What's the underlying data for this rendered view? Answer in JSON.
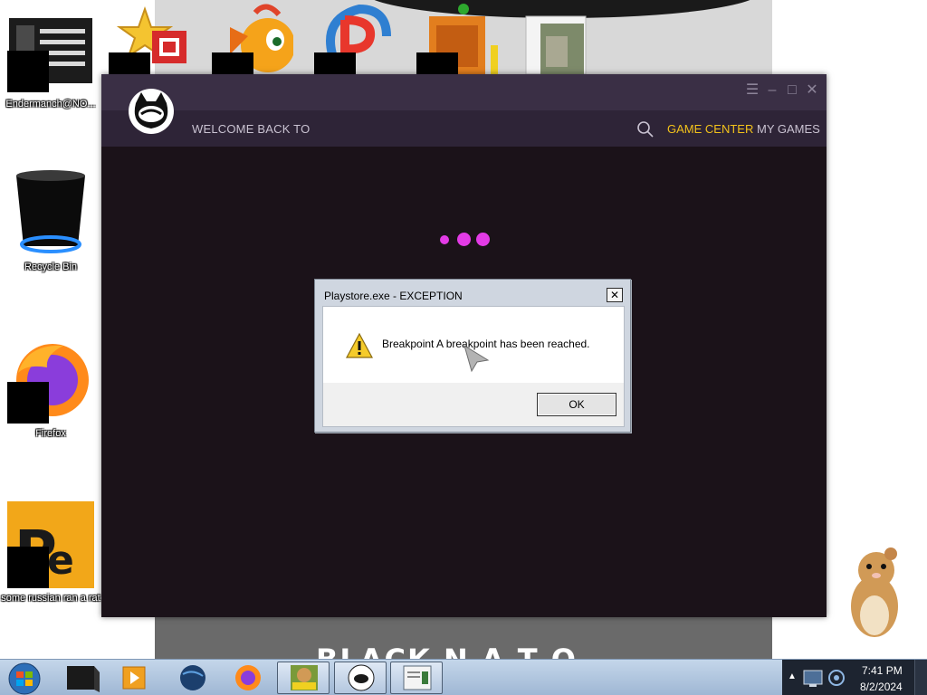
{
  "desktop": {
    "icons": [
      {
        "label": "Endermanch@NO...",
        "icon": "notepad-icon"
      },
      {
        "label": "Recycle Bin",
        "icon": "recycle-bin-icon"
      },
      {
        "label": "Firefox",
        "icon": "firefox-icon"
      },
      {
        "label": "some russian ran a rat",
        "icon": "pe-icon"
      }
    ]
  },
  "background_window": {
    "bottom_text": "BLACK N A T O"
  },
  "launcher": {
    "welcome": "WELCOME BACK TO",
    "nav": {
      "game_center": "GAME CENTER",
      "my_games": "MY GAMES"
    },
    "accent_color": "#f2c21b",
    "loader_color": "#e33be6"
  },
  "dialog": {
    "title": "Playstore.exe - EXCEPTION",
    "close_label": "✕",
    "message": "Breakpoint A breakpoint has been reached.",
    "ok_label": "OK"
  },
  "taskbar": {
    "time": "7:41 PM",
    "date": "8/2/2024"
  }
}
